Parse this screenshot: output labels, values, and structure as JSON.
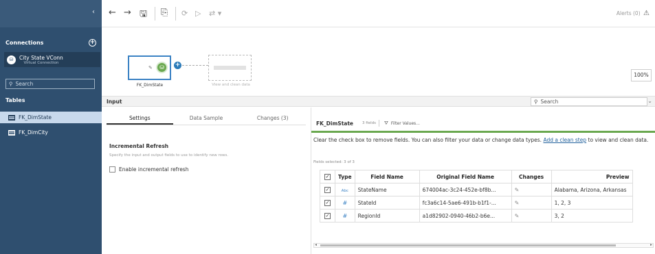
{
  "sidebar": {
    "collapse_icon": "‹",
    "connections_label": "Connections",
    "add_icon": "+",
    "connection": {
      "name": "City State VConn",
      "sub": "Virtual Connection"
    },
    "search_placeholder": "Search",
    "tables_label": "Tables",
    "tables": [
      {
        "name": "FK_DimState"
      },
      {
        "name": "FK_DimCity"
      }
    ]
  },
  "toolbar": {
    "back": "←",
    "forward": "→",
    "save": "🖫",
    "publish": "⎘",
    "refresh": "⟳",
    "run": "▷",
    "options": "⇄ ▾",
    "alerts": "Alerts (0)",
    "alert_icon": "⚠"
  },
  "canvas": {
    "node_label": "FK_DimState",
    "ghost_label": "View and clean data",
    "zoom": "100%"
  },
  "input_bar": {
    "title": "Input",
    "search_placeholder": "Search",
    "chevron": "⌄"
  },
  "settings": {
    "tabs": [
      "Settings",
      "Data Sample",
      "Changes (3)"
    ],
    "incremental_title": "Incremental Refresh",
    "incremental_desc": "Specify the input and output fields to use to identify new rows.",
    "incremental_checkbox": "Enable incremental refresh"
  },
  "fields": {
    "table_name": "FK_DimState",
    "count": "3 fields",
    "filter": "Filter Values...",
    "info_text": "Clear the check box to remove fields. You can also filter your data or change data types.",
    "info_link": "Add a clean step",
    "info_tail": " to view and clean data.",
    "selected": "Fields selected: 3 of 3",
    "headers": [
      "Type",
      "Field Name",
      "Original Field Name",
      "Changes",
      "Preview"
    ],
    "rows": [
      {
        "type": "Abc",
        "name": "StateName",
        "orig": "674004ac-3c24-452e-bf8b...",
        "preview": "Alabama, Arizona, Arkansas"
      },
      {
        "type": "#",
        "name": "StateId",
        "orig": "fc3a6c14-5ae6-491b-b1f1-...",
        "preview": "1, 2, 3"
      },
      {
        "type": "#",
        "name": "RegionId",
        "orig": "a1d82902-0940-46b2-b6e...",
        "preview": "3, 2"
      }
    ]
  },
  "colors": {
    "sidebar": "#2f4f6f",
    "accent_green": "#6aa84f",
    "accent_blue": "#3b82c4"
  }
}
